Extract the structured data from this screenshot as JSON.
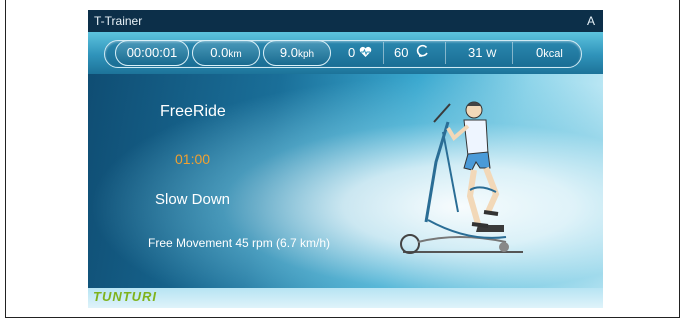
{
  "window": {
    "title": "T-Trainer",
    "badge": "A"
  },
  "stats": {
    "time": "00:00:01",
    "distance": {
      "value": "0.0",
      "unit": "km"
    },
    "speed": {
      "value": "9.0",
      "unit": "kph"
    },
    "heart_rate": "0",
    "cadence": "60",
    "power": {
      "value": "31",
      "unit": "W"
    },
    "energy": {
      "value": "0",
      "unit": "kcal"
    }
  },
  "workout": {
    "name": "FreeRide",
    "countdown": "01:00",
    "status": "Slow Down",
    "instruction": "Free Movement 45 rpm (6.7 km/h)"
  },
  "brand": {
    "logo": "TUNTURI"
  },
  "icons": {
    "heart": "heart-icon",
    "cadence": "cadence-icon"
  },
  "colors": {
    "timer": "#f0a030",
    "logo": "#7fb21c",
    "accent": "#2f93ba"
  }
}
